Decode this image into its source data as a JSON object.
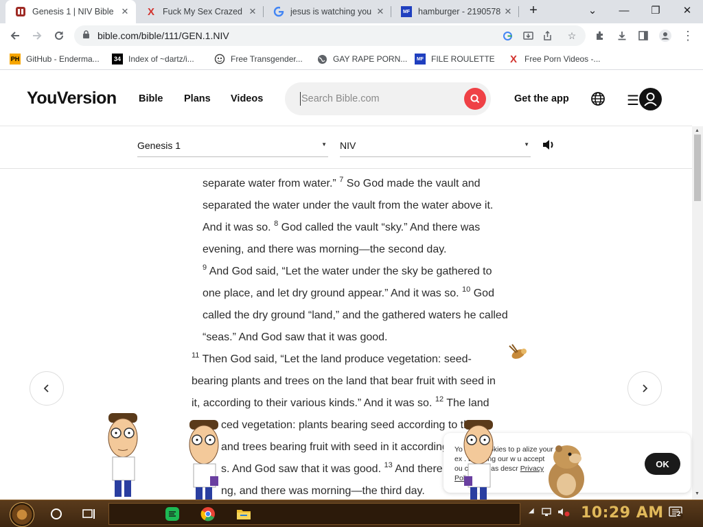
{
  "tabs": [
    {
      "title": "Genesis 1 | NIV Bible",
      "active": true
    },
    {
      "title": "Fuck My Sex Crazed",
      "active": false
    },
    {
      "title": "jesus is watching you",
      "active": false
    },
    {
      "title": "hamburger - 2190578",
      "active": false
    }
  ],
  "window_controls": {
    "dropdown": "⌄",
    "minimize": "—",
    "maximize": "❐",
    "close": "✕"
  },
  "omnibox": {
    "url": "bible.com/bible/111/GEN.1.NIV"
  },
  "bookmarks": [
    {
      "label": "GitHub - Enderma...",
      "icon": "PH"
    },
    {
      "label": "Index of ~dartz/i...",
      "icon": "34"
    },
    {
      "label": "Free Transgender...",
      "icon": "globe"
    },
    {
      "label": "GAY RAPE PORN...",
      "icon": "globe"
    },
    {
      "label": "FILE ROULETTE",
      "icon": "MF"
    },
    {
      "label": "Free Porn Videos -...",
      "icon": "X"
    }
  ],
  "site": {
    "logo": "YouVersion",
    "nav": {
      "bible": "Bible",
      "plans": "Plans",
      "videos": "Videos"
    },
    "search_placeholder": "Search Bible.com",
    "get_app": "Get the app",
    "menu_glyph": "☰"
  },
  "reader": {
    "chapter": "Genesis 1",
    "version": "NIV"
  },
  "verses": {
    "l1a": "separate water from water.”",
    "v7": "7",
    "l1b": "So God made the vault and",
    "l2": "separated the water under the vault from the water above it.",
    "l3a": "And it was so.",
    "v8": "8",
    "l3b": "God called the vault “sky.” And there was",
    "l4": "evening, and there was morning—the second day.",
    "v9": "9",
    "l5": "And God said, “Let the water under the sky be gathered to",
    "l6a": "one place, and let dry ground appear.” And it was so.",
    "v10": "10",
    "l6b": "God",
    "l7": "called the dry ground “land,” and the gathered waters he called",
    "l8": "“seas.” And God saw that it was good.",
    "v11": "11",
    "l9": "Then God said, “Let the land produce vegetation: seed-",
    "l10": "bearing plants and trees on the land that bear fruit with seed in",
    "l11a": "it, according to their various kinds.” And it was so.",
    "v12": "12",
    "l11b": "The land",
    "l12": "ced vegetation: plants bearing seed according to th",
    "l13": "and trees bearing fruit with seed in it according",
    "l14a": "s. And God saw that it was good.",
    "v13": "13",
    "l14b": "And there w",
    "l15": "ng, and there was morning—the third day."
  },
  "cookie": {
    "l1": "Yo         uses cookies to p       alize your",
    "l2": "ex       . By using our w          u accept",
    "l3": "ou        cookies as descr",
    "l3_link": "Privacy",
    "l4_link": "Polic",
    "ok": "OK"
  },
  "taskbar": {
    "clock": "10:29 AM",
    "notifications": "2"
  }
}
